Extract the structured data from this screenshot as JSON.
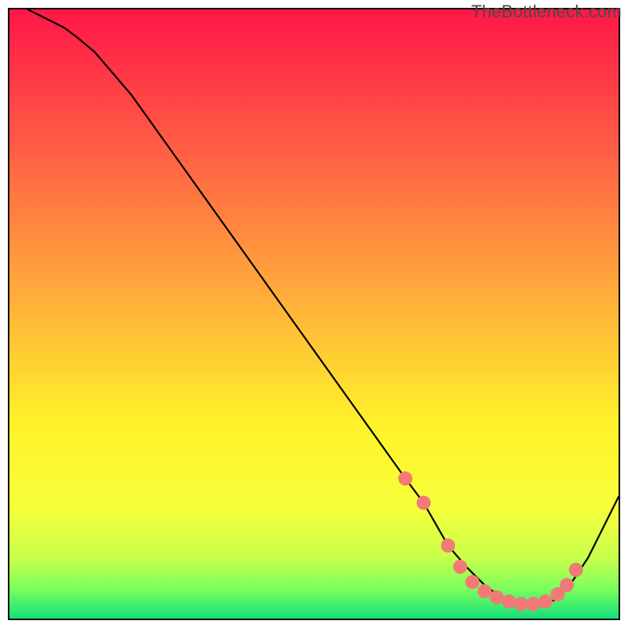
{
  "watermark": "TheBottleneck.com",
  "colors": {
    "gradient_top": "#ff1748",
    "gradient_mid_high": "#ff8b3e",
    "gradient_mid": "#fff22a",
    "gradient_low": "#d7ff4a",
    "gradient_bottom": "#14e07a",
    "curve": "#000000",
    "dots": "#f17a77",
    "border": "#000000"
  },
  "chart_data": {
    "type": "line",
    "title": "",
    "xlabel": "",
    "ylabel": "",
    "xlim": [
      0,
      100
    ],
    "ylim": [
      0,
      100
    ],
    "grid": false,
    "legend": false,
    "annotations": [
      "TheBottleneck.com"
    ],
    "series": [
      {
        "name": "bottleneck-curve",
        "x": [
          3,
          5,
          7,
          9,
          11,
          14,
          20,
          30,
          40,
          50,
          60,
          65,
          68,
          70,
          72,
          75,
          78,
          80,
          82,
          84,
          86,
          88,
          90,
          92,
          95,
          100
        ],
        "y": [
          100,
          99,
          98,
          97,
          95.5,
          93,
          86,
          72,
          58,
          44,
          30,
          23,
          19,
          15.5,
          12,
          8.5,
          5.5,
          4,
          3,
          2.4,
          2.2,
          2.4,
          3.3,
          5.5,
          10,
          20
        ]
      }
    ],
    "markers": [
      {
        "x": 65,
        "y": 23
      },
      {
        "x": 68,
        "y": 19
      },
      {
        "x": 72,
        "y": 12
      },
      {
        "x": 74,
        "y": 8.5
      },
      {
        "x": 76,
        "y": 6
      },
      {
        "x": 78,
        "y": 4.5
      },
      {
        "x": 80,
        "y": 3.5
      },
      {
        "x": 82,
        "y": 2.8
      },
      {
        "x": 84,
        "y": 2.4
      },
      {
        "x": 86,
        "y": 2.4
      },
      {
        "x": 88,
        "y": 2.8
      },
      {
        "x": 90,
        "y": 4.0
      },
      {
        "x": 91.5,
        "y": 5.5
      },
      {
        "x": 93,
        "y": 8.0
      }
    ]
  }
}
